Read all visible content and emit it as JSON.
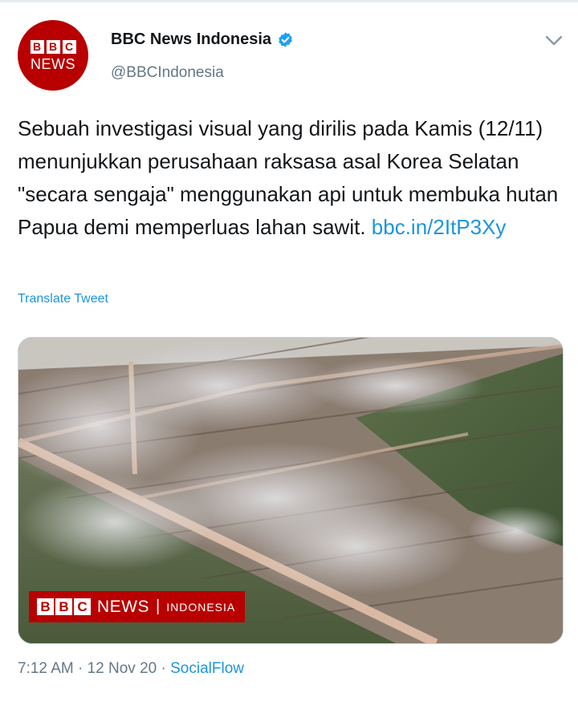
{
  "account": {
    "avatar_blocks": [
      "B",
      "B",
      "C"
    ],
    "avatar_news": "NEWS",
    "display_name": "BBC News Indonesia",
    "handle": "@BBCIndonesia",
    "verified_icon": "verified-badge-icon",
    "menu_icon": "chevron-down-icon"
  },
  "tweet": {
    "text": "Sebuah investigasi visual yang dirilis pada Kamis (12/11) menunjukkan perusahaan raksasa asal Korea Selatan \"secara sengaja\" menggunakan api untuk membuka hutan Papua demi memperluas lahan sawit. ",
    "link": "bbc.in/2ItP3Xy",
    "translate_label": "Translate Tweet"
  },
  "media": {
    "overlay_blocks": [
      "B",
      "B",
      "C"
    ],
    "overlay_news": "NEWS",
    "overlay_separator": "|",
    "overlay_region": "INDONESIA"
  },
  "footer": {
    "time": "7:12 AM",
    "dot1": " · ",
    "date": "12 Nov 20",
    "dot2": " · ",
    "source": "SocialFlow"
  },
  "colors": {
    "bbc_red": "#b80000",
    "link_blue": "#1b95e0",
    "text": "#14171a",
    "secondary": "#657786"
  }
}
